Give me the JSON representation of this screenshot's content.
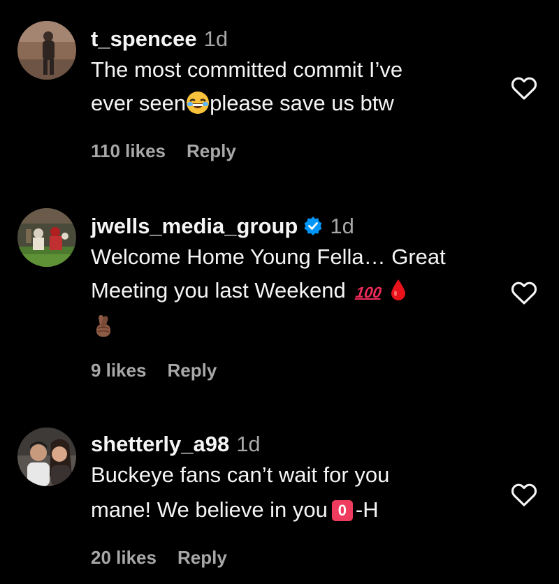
{
  "comments": [
    {
      "username": "t_spencee",
      "time": "1d",
      "line1": "The most committed commit I’ve",
      "line2a": "ever seen",
      "line2b": "please save us btw",
      "likes": "110 likes",
      "reply": "Reply"
    },
    {
      "username": "jwells_media_group",
      "time": "1d",
      "line1": "Welcome Home Young Fella… Great",
      "line2": "Meeting you last Weekend",
      "hundred": "100",
      "likes": "9 likes",
      "reply": "Reply"
    },
    {
      "username": "shetterly_a98",
      "time": "1d",
      "line1": "Buckeye fans can’t wait for you",
      "line2a": "mane! We believe in you",
      "zero": "0",
      "line2b": "-H",
      "likes": "20 likes",
      "reply": "Reply"
    }
  ],
  "colors": {
    "background": "#000000",
    "text": "#f5f5f5",
    "secondary": "#a8a8a8",
    "verified": "#0095f6"
  },
  "icons": [
    "heart-icon",
    "verified-badge-icon",
    "laughing-emoji-icon",
    "hundred-points-emoji-icon",
    "drop-of-blood-emoji-icon",
    "crossed-fingers-emoji-icon",
    "keycap-zero-emoji-icon"
  ]
}
